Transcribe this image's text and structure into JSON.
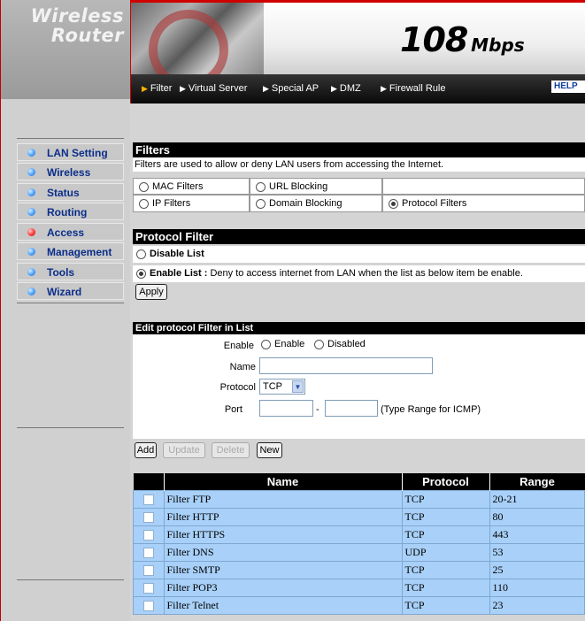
{
  "brand": {
    "line1": "Wireless",
    "line2": "Router",
    "speed_num": "108",
    "speed_unit": "Mbps"
  },
  "sidebar": {
    "items": [
      {
        "label": "LAN Setting"
      },
      {
        "label": "Wireless"
      },
      {
        "label": "Status"
      },
      {
        "label": "Routing"
      },
      {
        "label": "Access"
      },
      {
        "label": "Management"
      },
      {
        "label": "Tools"
      },
      {
        "label": "Wizard"
      }
    ],
    "active": "Access"
  },
  "nav": {
    "items": [
      "Filter",
      "Virtual Server",
      "Special AP",
      "DMZ",
      "Firewall Rule"
    ],
    "help": "HELP"
  },
  "filters": {
    "title": "Filters",
    "description": "Filters are used to allow or deny LAN users from accessing the Internet.",
    "options": {
      "mac": "MAC Filters",
      "url": "URL Blocking",
      "ip": "IP Filters",
      "domain": "Domain Blocking",
      "protocol": "Protocol Filters"
    },
    "selected": "Protocol Filters"
  },
  "protocol_filter": {
    "title": "Protocol Filter",
    "disable_label": "Disable List",
    "enable_label": "Enable List :",
    "enable_desc": "Deny to access internet from LAN when the list as below item be enable.",
    "apply": "Apply"
  },
  "edit": {
    "title": "Edit protocol Filter in List",
    "enable_label": "Enable",
    "enable_opt": "Enable",
    "disabled_opt": "Disabled",
    "name_label": "Name",
    "name_value": "",
    "protocol_label": "Protocol",
    "protocol_value": "TCP",
    "port_label": "Port",
    "port_from": "",
    "port_sep": "-",
    "port_to": "",
    "port_hint": "(Type Range for ICMP)"
  },
  "buttons": {
    "add": "Add",
    "update": "Update",
    "delete": "Delete",
    "new": "New"
  },
  "table": {
    "headers": [
      "Name",
      "Protocol",
      "Range"
    ],
    "rows": [
      {
        "name": "Filter FTP",
        "protocol": "TCP",
        "range": "20-21"
      },
      {
        "name": "Filter HTTP",
        "protocol": "TCP",
        "range": "80"
      },
      {
        "name": "Filter HTTPS",
        "protocol": "TCP",
        "range": "443"
      },
      {
        "name": "Filter DNS",
        "protocol": "UDP",
        "range": "53"
      },
      {
        "name": "Filter SMTP",
        "protocol": "TCP",
        "range": "25"
      },
      {
        "name": "Filter POP3",
        "protocol": "TCP",
        "range": "110"
      },
      {
        "name": "Filter Telnet",
        "protocol": "TCP",
        "range": "23"
      }
    ]
  }
}
